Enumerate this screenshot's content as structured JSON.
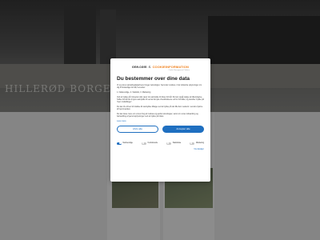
{
  "page": {
    "banner_text": "HILLERØD BORGERSTIFTEL"
  },
  "consent": {
    "brand_name": "one.com",
    "brand_amp": "&",
    "brand_partner": "COOKIEINFORMATION",
    "brand_partner_sub": "Cookie Management Platform",
    "title": "Du bestemmer over dine data",
    "paragraphs": [
      "Vi og vores samarbejdspartnere bruger teknologier, herunder cookies, til at indsamle oplysninger om dig til forskellige formål, herunder:",
      "1. Nødvendige, 2. Statistik, 3. Marketing",
      "Ved at trykke på 'Accepter alle' giver du samtykke til disse formål. Du kan også vælge at tilkendegive, hvilke formål du vil give samtykke til ved at benytte checkboksene ud for formålet, og derefter trykke på 'Gem indstillinger'.",
      "Du kan til enhver tid trække dit samtykke tilbage ved at trykke på det lille ikon nederst i venstre hjørne af hjemmesiden.",
      "Du kan læse mere om vores brug af cookies og andre teknologier, samt om vores indsamling og behandling af personoplysninger ved at trykke på linket."
    ],
    "more_link": "Læs mere",
    "deny_label": "Afvis alle",
    "accept_label": "Accepter alle",
    "toggles": [
      {
        "label": "Nødvendige",
        "on": true
      },
      {
        "label": "Funktionelle",
        "on": false
      },
      {
        "label": "Statistiske",
        "on": false
      },
      {
        "label": "Marketing",
        "on": false
      }
    ],
    "details_link": "Vis detaljer",
    "accent_color": "#1f6fc0"
  }
}
